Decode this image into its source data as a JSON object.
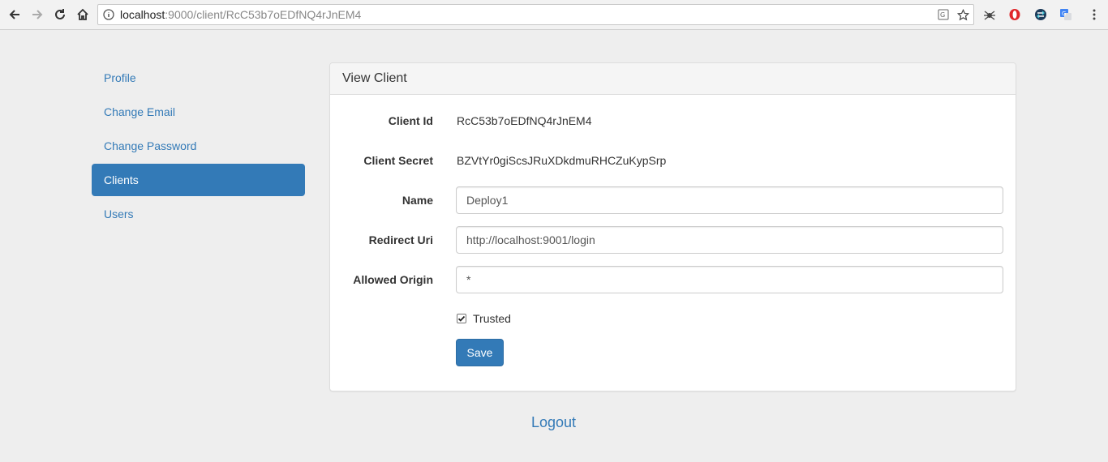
{
  "browser": {
    "url_host": "localhost",
    "url_path": ":9000/client/RcC53b7oEDfNQ4rJnEM4",
    "icons": [
      "back-icon",
      "forward-icon",
      "reload-icon",
      "home-icon",
      "info-icon",
      "translate-icon",
      "star-icon",
      "ext-spider-icon",
      "ext-opera-icon",
      "ext-sync-icon",
      "ext-translate-icon",
      "menu-icon"
    ]
  },
  "sidebar": {
    "items": [
      {
        "label": "Profile",
        "active": false
      },
      {
        "label": "Change Email",
        "active": false
      },
      {
        "label": "Change Password",
        "active": false
      },
      {
        "label": "Clients",
        "active": true
      },
      {
        "label": "Users",
        "active": false
      }
    ]
  },
  "panel": {
    "title": "View Client",
    "client_id_label": "Client Id",
    "client_id_value": "RcC53b7oEDfNQ4rJnEM4",
    "client_secret_label": "Client Secret",
    "client_secret_value": "BZVtYr0giScsJRuXDkdmuRHCZuKypSrp",
    "name_label": "Name",
    "name_value": "Deploy1",
    "redirect_label": "Redirect Uri",
    "redirect_value": "http://localhost:9001/login",
    "origin_label": "Allowed Origin",
    "origin_value": "*",
    "trusted_label": "Trusted",
    "trusted_checked": true,
    "save_label": "Save"
  },
  "footer": {
    "logout_label": "Logout"
  },
  "colors": {
    "accent": "#337ab7",
    "background": "#eeeeee"
  }
}
